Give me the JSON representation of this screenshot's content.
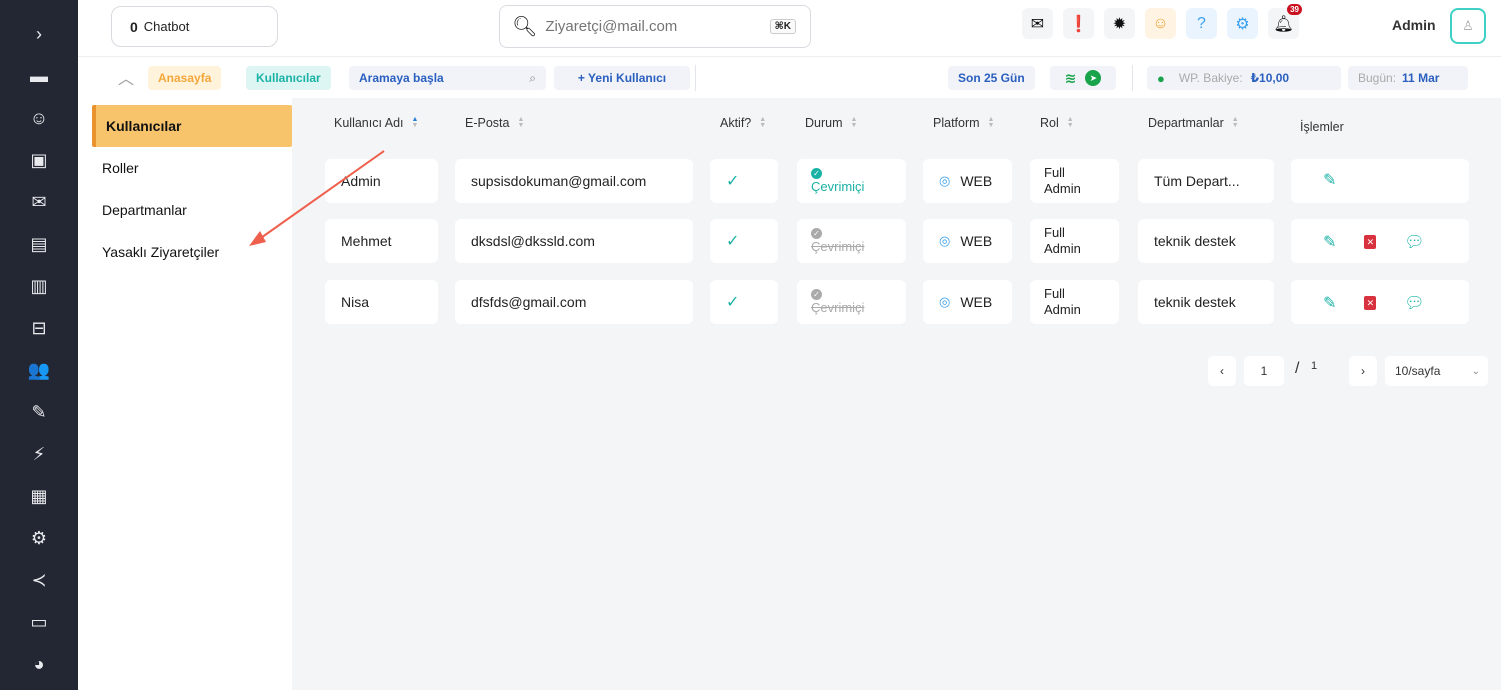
{
  "topbar": {
    "chatbot_count": "0",
    "chatbot_label": "Chatbot",
    "search_placeholder": "Ziyaretçi@mail.com",
    "search_shortcut": "⌘K",
    "notification_badge": "39",
    "admin_name": "Admin"
  },
  "subbar": {
    "home": "Anasayfa",
    "users": "Kullanıcılar",
    "search_start": "Aramaya başla",
    "new_user": "+ Yeni Kullanıcı",
    "days": "Son 25 Gün",
    "wp_balance_label": "WP. Bakiye:",
    "wp_balance_value": "₺10,00",
    "today_label": "Bugün:",
    "today_value": "11 Mar"
  },
  "leftnav": {
    "items": [
      "Kullanıcılar",
      "Roller",
      "Departmanlar",
      "Yasaklı Ziyaretçiler"
    ]
  },
  "table": {
    "headers": [
      "Kullanıcı Adı",
      "E-Posta",
      "Aktif?",
      "Durum",
      "Platform",
      "Rol",
      "Departmanlar",
      "İşlemler"
    ],
    "rows": [
      {
        "name": "Admin",
        "email": "supsisdokuman@gmail.com",
        "active": "✓",
        "status": "Çevrimiçi",
        "online": true,
        "platform": "WEB",
        "role1": "Full",
        "role2": "Admin",
        "department": "Tüm Depart..."
      },
      {
        "name": "Mehmet",
        "email": "dksdsl@dkssld.com",
        "active": "✓",
        "status": "Çevrimiçi",
        "online": false,
        "platform": "WEB",
        "role1": "Full",
        "role2": "Admin",
        "department": "teknik destek"
      },
      {
        "name": "Nisa",
        "email": "dfsfds@gmail.com",
        "active": "✓",
        "status": "Çevrimiçi",
        "online": false,
        "platform": "WEB",
        "role1": "Full",
        "role2": "Admin",
        "department": "teknik destek"
      }
    ]
  },
  "pagination": {
    "prev": "‹",
    "current": "1",
    "slash": "/",
    "total": "1",
    "next": "›",
    "page_size": "10/sayfa"
  },
  "colors": {
    "rail": "#232733",
    "accent_orange": "#f7c46c",
    "teal": "#1bb2a6",
    "blue": "#2a5fbf",
    "arrow": "#ee5f4c"
  }
}
